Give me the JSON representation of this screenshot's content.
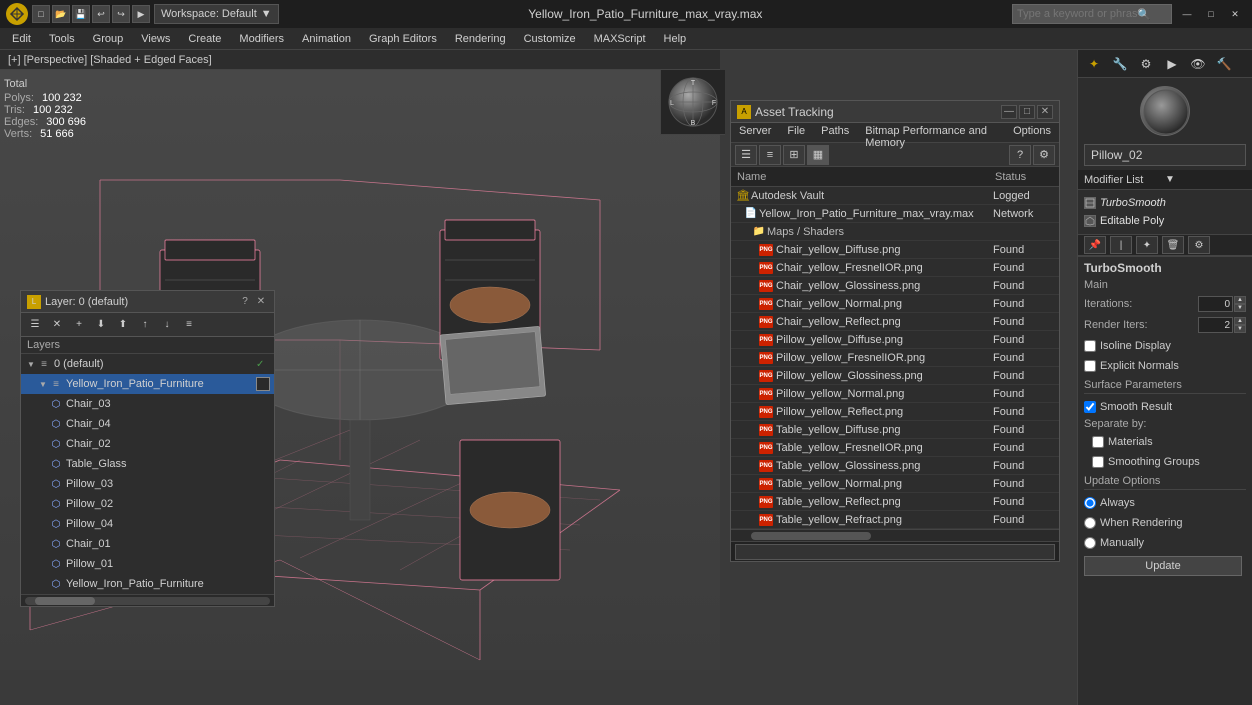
{
  "titlebar": {
    "logo_label": "3",
    "workspace_label": "Workspace: Default",
    "title": "Yellow_Iron_Patio_Furniture_max_vray.max",
    "search_placeholder": "Type a keyword or phrase",
    "minimize": "—",
    "maximize": "□",
    "close": "✕"
  },
  "menubar": {
    "items": [
      {
        "label": "Edit"
      },
      {
        "label": "Tools"
      },
      {
        "label": "Group"
      },
      {
        "label": "Views"
      },
      {
        "label": "Create"
      },
      {
        "label": "Modifiers"
      },
      {
        "label": "Animation"
      },
      {
        "label": "Graph Editors"
      },
      {
        "label": "Rendering"
      },
      {
        "label": "Customize"
      },
      {
        "label": "MAXScript"
      },
      {
        "label": "Help"
      }
    ]
  },
  "viewport": {
    "info": "[+] [Perspective] [Shaded + Edged Faces]"
  },
  "stats": {
    "polys_label": "Polys:",
    "polys_value": "100 232",
    "tris_label": "Tris:",
    "tris_value": "100 232",
    "edges_label": "Edges:",
    "edges_value": "300 696",
    "verts_label": "Verts:",
    "verts_value": "51 666",
    "total_label": "Total"
  },
  "layer_panel": {
    "title": "Layer: 0 (default)",
    "close": "✕",
    "question": "?",
    "toolbar_icons": [
      "☰",
      "✕",
      "+",
      "⬇",
      "⬆",
      "↑",
      "↓"
    ],
    "layers_label": "Layers",
    "items": [
      {
        "indent": 0,
        "name": "0 (default)",
        "has_check": true,
        "has_expand": true,
        "level": 0
      },
      {
        "indent": 1,
        "name": "Yellow_Iron_Patio_Furniture",
        "has_check": false,
        "selected": true,
        "has_expand": true,
        "level": 1
      },
      {
        "indent": 2,
        "name": "Chair_03",
        "level": 2
      },
      {
        "indent": 2,
        "name": "Chair_04",
        "level": 2
      },
      {
        "indent": 2,
        "name": "Chair_02",
        "level": 2
      },
      {
        "indent": 2,
        "name": "Table_Glass",
        "level": 2
      },
      {
        "indent": 2,
        "name": "Pillow_03",
        "level": 2
      },
      {
        "indent": 2,
        "name": "Pillow_02",
        "level": 2
      },
      {
        "indent": 2,
        "name": "Pillow_04",
        "level": 2
      },
      {
        "indent": 2,
        "name": "Chair_01",
        "level": 2
      },
      {
        "indent": 2,
        "name": "Pillow_01",
        "level": 2
      },
      {
        "indent": 2,
        "name": "Yellow_Iron_Patio_Furniture",
        "level": 2
      }
    ]
  },
  "right_panel": {
    "object_name": "Pillow_02",
    "modifier_list_label": "Modifier List",
    "modifiers": [
      {
        "name": "TurboSmooth",
        "italic": true
      },
      {
        "name": "Editable Poly",
        "italic": false
      }
    ],
    "turbosmooth": {
      "label": "TurboSmooth",
      "main_label": "Main",
      "iterations_label": "Iterations:",
      "iterations_value": "0",
      "render_iters_label": "Render Iters:",
      "render_iters_value": "2",
      "isoline_display_label": "Isoline Display",
      "explicit_normals_label": "Explicit Normals",
      "surface_params_label": "Surface Parameters",
      "smooth_result_label": "Smooth Result",
      "separate_by_label": "Separate by:",
      "materials_label": "Materials",
      "smoothing_groups_label": "Smoothing Groups",
      "update_label": "Update Options",
      "always_label": "Always",
      "when_rendering_label": "When Rendering",
      "manually_label": "Manually",
      "update_btn": "Update"
    }
  },
  "asset_tracking": {
    "title": "Asset Tracking",
    "menus": [
      "Server",
      "File",
      "Paths",
      "Bitmap Performance and Memory",
      "Options"
    ],
    "toolbar_icons": [
      "☰",
      "≡",
      "⊞",
      "▦"
    ],
    "columns": [
      "Name",
      "Status"
    ],
    "rows": [
      {
        "indent": 0,
        "icon": "vault",
        "name": "Autodesk Vault",
        "status": "Logged"
      },
      {
        "indent": 1,
        "icon": "file",
        "name": "Yellow_Iron_Patio_Furniture_max_vray.max",
        "status": "Network"
      },
      {
        "indent": 2,
        "icon": "folder",
        "name": "Maps / Shaders",
        "status": ""
      },
      {
        "indent": 3,
        "icon": "png",
        "name": "Chair_yellow_Diffuse.png",
        "status": "Found"
      },
      {
        "indent": 3,
        "icon": "png",
        "name": "Chair_yellow_FresnelIOR.png",
        "status": "Found"
      },
      {
        "indent": 3,
        "icon": "png",
        "name": "Chair_yellow_Glossiness.png",
        "status": "Found"
      },
      {
        "indent": 3,
        "icon": "png",
        "name": "Chair_yellow_Normal.png",
        "status": "Found"
      },
      {
        "indent": 3,
        "icon": "png",
        "name": "Chair_yellow_Reflect.png",
        "status": "Found"
      },
      {
        "indent": 3,
        "icon": "png",
        "name": "Pillow_yellow_Diffuse.png",
        "status": "Found"
      },
      {
        "indent": 3,
        "icon": "png",
        "name": "Pillow_yellow_FresnelIOR.png",
        "status": "Found"
      },
      {
        "indent": 3,
        "icon": "png",
        "name": "Pillow_yellow_Glossiness.png",
        "status": "Found"
      },
      {
        "indent": 3,
        "icon": "png",
        "name": "Pillow_yellow_Normal.png",
        "status": "Found"
      },
      {
        "indent": 3,
        "icon": "png",
        "name": "Pillow_yellow_Reflect.png",
        "status": "Found"
      },
      {
        "indent": 3,
        "icon": "png",
        "name": "Table_yellow_Diffuse.png",
        "status": "Found"
      },
      {
        "indent": 3,
        "icon": "png",
        "name": "Table_yellow_FresnelIOR.png",
        "status": "Found"
      },
      {
        "indent": 3,
        "icon": "png",
        "name": "Table_yellow_Glossiness.png",
        "status": "Found"
      },
      {
        "indent": 3,
        "icon": "png",
        "name": "Table_yellow_Normal.png",
        "status": "Found"
      },
      {
        "indent": 3,
        "icon": "png",
        "name": "Table_yellow_Reflect.png",
        "status": "Found"
      },
      {
        "indent": 3,
        "icon": "png",
        "name": "Table_yellow_Refract.png",
        "status": "Found"
      }
    ]
  }
}
